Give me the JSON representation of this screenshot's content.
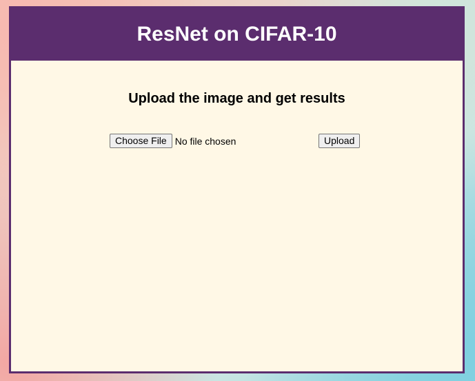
{
  "header": {
    "title": "ResNet on CIFAR-10"
  },
  "main": {
    "subtitle": "Upload the image and get results",
    "file_input": {
      "button_label": "Choose File",
      "status": "No file chosen"
    },
    "upload_button_label": "Upload"
  },
  "colors": {
    "header_bg": "#5b2d6e",
    "card_bg": "#fff8e6",
    "title_text": "#ffffff"
  }
}
